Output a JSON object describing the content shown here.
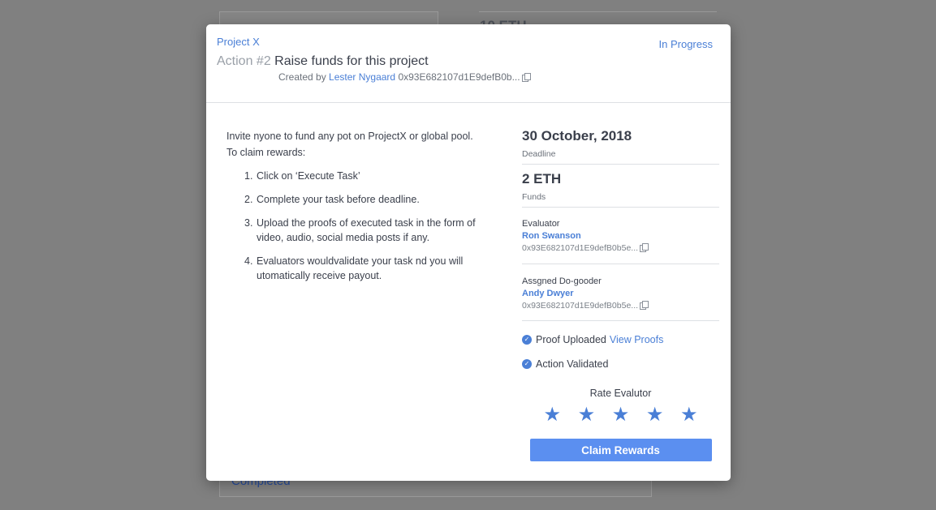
{
  "background": {
    "eth_value": "10 ETH",
    "completed_label": "Completed"
  },
  "modal": {
    "project_name": "Project X",
    "status": "In Progress",
    "action_number": "Action #2",
    "action_title": "Raise funds for this project",
    "created_by_prefix": "Created by",
    "creator_name": "Lester Nygaard",
    "creator_address": "0x93E682107d1E9defB0b...",
    "description": {
      "intro": "Invite nyone to fund any pot on ProjectX or global pool.",
      "claim_heading": "To claim rewards:",
      "steps": [
        {
          "num": "1.",
          "text": "Click on ‘Execute Task’"
        },
        {
          "num": "2.",
          "text": "Complete your task before deadline."
        },
        {
          "num": "3.",
          "text": "Upload the proofs of executed task in the form of video, audio, social media posts if any."
        },
        {
          "num": "4.",
          "text": "Evaluators wouldvalidate your task nd you will utomatically receive payout."
        }
      ]
    },
    "deadline": {
      "value": "30 October, 2018",
      "label": "Deadline"
    },
    "funds": {
      "value": "2 ETH",
      "label": "Funds"
    },
    "evaluator": {
      "title": "Evaluator",
      "name": "Ron Swanson",
      "address": "0x93E682107d1E9defB0b5e..."
    },
    "assigned": {
      "title": "Assgned Do-gooder",
      "name": "Andy Dwyer",
      "address": "0x93E682107d1E9defB0b5e..."
    },
    "proof": {
      "label": "Proof Uploaded",
      "link": "View Proofs"
    },
    "validated": {
      "label": "Action Validated"
    },
    "rating": {
      "label": "Rate Evalutor",
      "stars": 5,
      "star_glyph": "★"
    },
    "claim_button": "Claim Rewards"
  },
  "colors": {
    "accent": "#4a7fd6",
    "button": "#5b8ff0",
    "overlay": "#808080"
  }
}
